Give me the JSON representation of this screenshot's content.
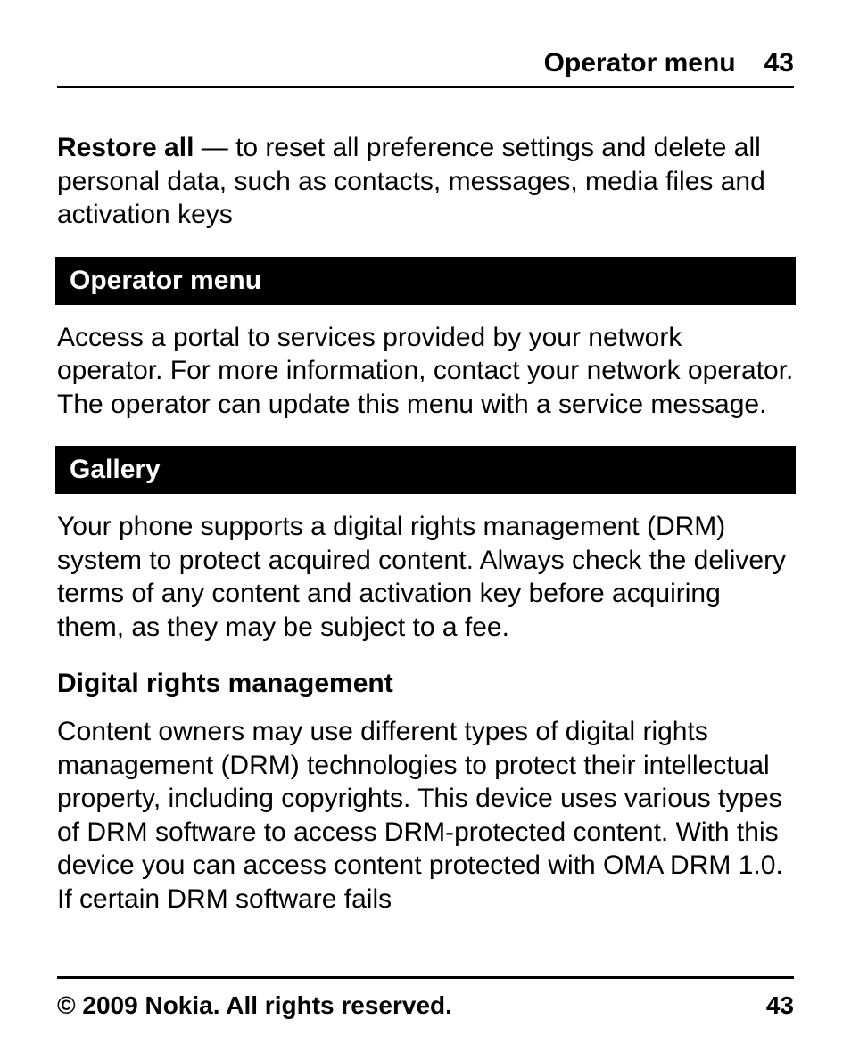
{
  "header": {
    "title": "Operator menu",
    "page": "43"
  },
  "body": {
    "restore": {
      "lead": "Restore all",
      "text": " — to reset all preference settings and delete all personal data, such as contacts, messages, media files and activation keys"
    },
    "operator": {
      "heading": "Operator menu",
      "text": "Access a portal to services provided by your network operator. For more information, contact your network operator. The operator can update this menu with a service message."
    },
    "gallery": {
      "heading": "Gallery",
      "intro": "Your phone supports a digital rights management (DRM) system to protect acquired content. Always check the delivery terms of any content and activation key before acquiring them, as they may be subject to a fee.",
      "subhead": "Digital rights management",
      "drm": "Content owners may use different types of digital rights management (DRM) technologies to protect their intellectual property, including copyrights. This device uses various types of DRM software to access DRM-protected content. With this device you can access content protected with OMA DRM 1.0. If certain DRM software fails"
    }
  },
  "footer": {
    "copyright": "© 2009 Nokia. All rights reserved.",
    "page": "43"
  }
}
